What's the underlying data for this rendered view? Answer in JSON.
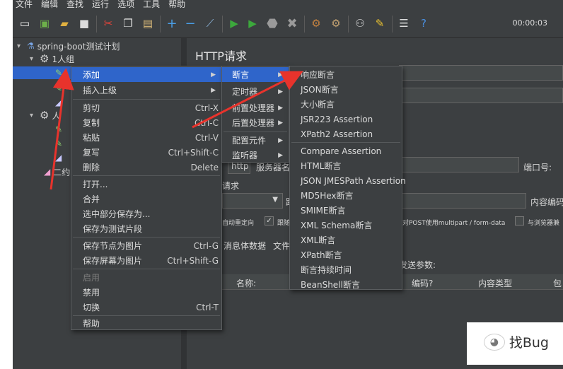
{
  "menubar": [
    "文件",
    "编辑",
    "查找",
    "运行",
    "选项",
    "工具",
    "帮助"
  ],
  "toolbar": {
    "timer": "00:00:03",
    "icons": [
      "new-icon",
      "templates-icon",
      "open-icon",
      "save-icon",
      "cut-icon",
      "copy-icon",
      "paste-icon",
      "expand-icon",
      "collapse-icon",
      "toggle-icon",
      "start-icon",
      "start-no-pause-icon",
      "stop-icon",
      "shutdown-icon",
      "clear-icon",
      "clear-all-icon",
      "search-icon",
      "reset-search-icon",
      "function-helper-icon",
      "help-icon"
    ]
  },
  "tree": {
    "root": "spring-boot测试计划",
    "group1": "1人组",
    "group2_partial": "人",
    "group3_partial": "二约"
  },
  "panel": {
    "title": "HTTP请求",
    "protocol_value": "http",
    "server_label": "服务器名",
    "port_label": "端口号:",
    "request_label": "请求",
    "path_prefix": "路",
    "content_encoding_label": "内容编码",
    "auto_redirect": "自动重定向",
    "follow_redirect": "跟随",
    "multipart_label": "对POST使用multipart / form-data",
    "browser_headers": "与浏览器兼",
    "body_tab": "消息体数据",
    "files_tab": "文件",
    "send_params": "发送参数:",
    "col_name": "名称:",
    "col_encode": "编码?",
    "col_content_type": "内容类型",
    "col_include": "包"
  },
  "context_menu": {
    "items": [
      {
        "label": "添加",
        "shortcut": "",
        "submenu": true
      },
      {
        "label": "插入上级",
        "shortcut": "",
        "submenu": true
      },
      {
        "label": "剪切",
        "shortcut": "Ctrl-X"
      },
      {
        "label": "复制",
        "shortcut": "Ctrl-C"
      },
      {
        "label": "粘贴",
        "shortcut": "Ctrl-V"
      },
      {
        "label": "复写",
        "shortcut": "Ctrl+Shift-C"
      },
      {
        "label": "删除",
        "shortcut": "Delete"
      },
      {
        "label": "打开...",
        "shortcut": ""
      },
      {
        "label": "合并",
        "shortcut": ""
      },
      {
        "label": "选中部分保存为...",
        "shortcut": ""
      },
      {
        "label": "保存为测试片段",
        "shortcut": ""
      },
      {
        "label": "保存节点为图片",
        "shortcut": "Ctrl-G"
      },
      {
        "label": "保存屏幕为图片",
        "shortcut": "Ctrl+Shift-G"
      },
      {
        "label": "启用",
        "shortcut": ""
      },
      {
        "label": "禁用",
        "shortcut": ""
      },
      {
        "label": "切换",
        "shortcut": "Ctrl-T"
      },
      {
        "label": "帮助",
        "shortcut": ""
      }
    ]
  },
  "add_submenu": {
    "items": [
      "断言",
      "定时器",
      "前置处理器",
      "后置处理器",
      "配置元件",
      "监听器"
    ]
  },
  "assertion_submenu": {
    "items": [
      "响应断言",
      "JSON断言",
      "大小断言",
      "JSR223 Assertion",
      "XPath2 Assertion",
      "Compare Assertion",
      "HTML断言",
      "JSON JMESPath Assertion",
      "MD5Hex断言",
      "SMIME断言",
      "XML Schema断言",
      "XML断言",
      "XPath断言",
      "断言持续时间",
      "BeanShell断言"
    ]
  },
  "watermark": {
    "text": "找Bug"
  },
  "colors": {
    "background": "#3c3f41",
    "highlight": "#2f65ca",
    "annotation_arrow": "#e8332c"
  }
}
